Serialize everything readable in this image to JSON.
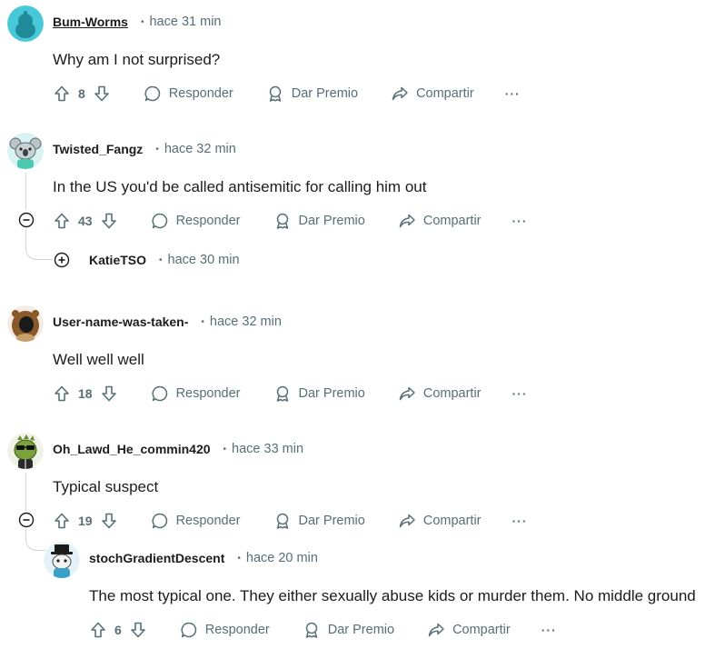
{
  "comments": [
    {
      "author": "Bum-Worms",
      "time": "hace 31 min",
      "text": "Why am I not surprised?",
      "score": "8",
      "avatar": "teal-default-avatar"
    },
    {
      "author": "Twisted_Fangz",
      "time": "hace 32 min",
      "text": "In the US you'd be called antisemitic for calling him out",
      "score": "43",
      "avatar": "koala-avatar",
      "collapsed_reply": {
        "author": "KatieTSO",
        "time": "hace 30 min"
      }
    },
    {
      "author": "User-name-was-taken-",
      "time": "hace 32 min",
      "text": "Well well well",
      "score": "18",
      "avatar": "brown-hood-avatar"
    },
    {
      "author": "Oh_Lawd_He_commin420",
      "time": "hace 33 min",
      "text": "Typical suspect",
      "score": "19",
      "avatar": "green-shades-avatar",
      "reply": {
        "author": "stochGradientDescent",
        "time": "hace 20 min",
        "text": "The most typical one. They either sexually abuse kids or murder them. No middle ground",
        "score": "6",
        "avatar": "top-hat-avatar"
      }
    }
  ],
  "actions": {
    "reply": "Responder",
    "award": "Dar Premio",
    "share": "Compartir",
    "more": "···"
  },
  "dot": "•",
  "colors": {
    "text": "#1c1c1c",
    "meta": "#576f76",
    "thread_line": "#d0d5d8",
    "avatar_teal": "#3fc2d6"
  }
}
